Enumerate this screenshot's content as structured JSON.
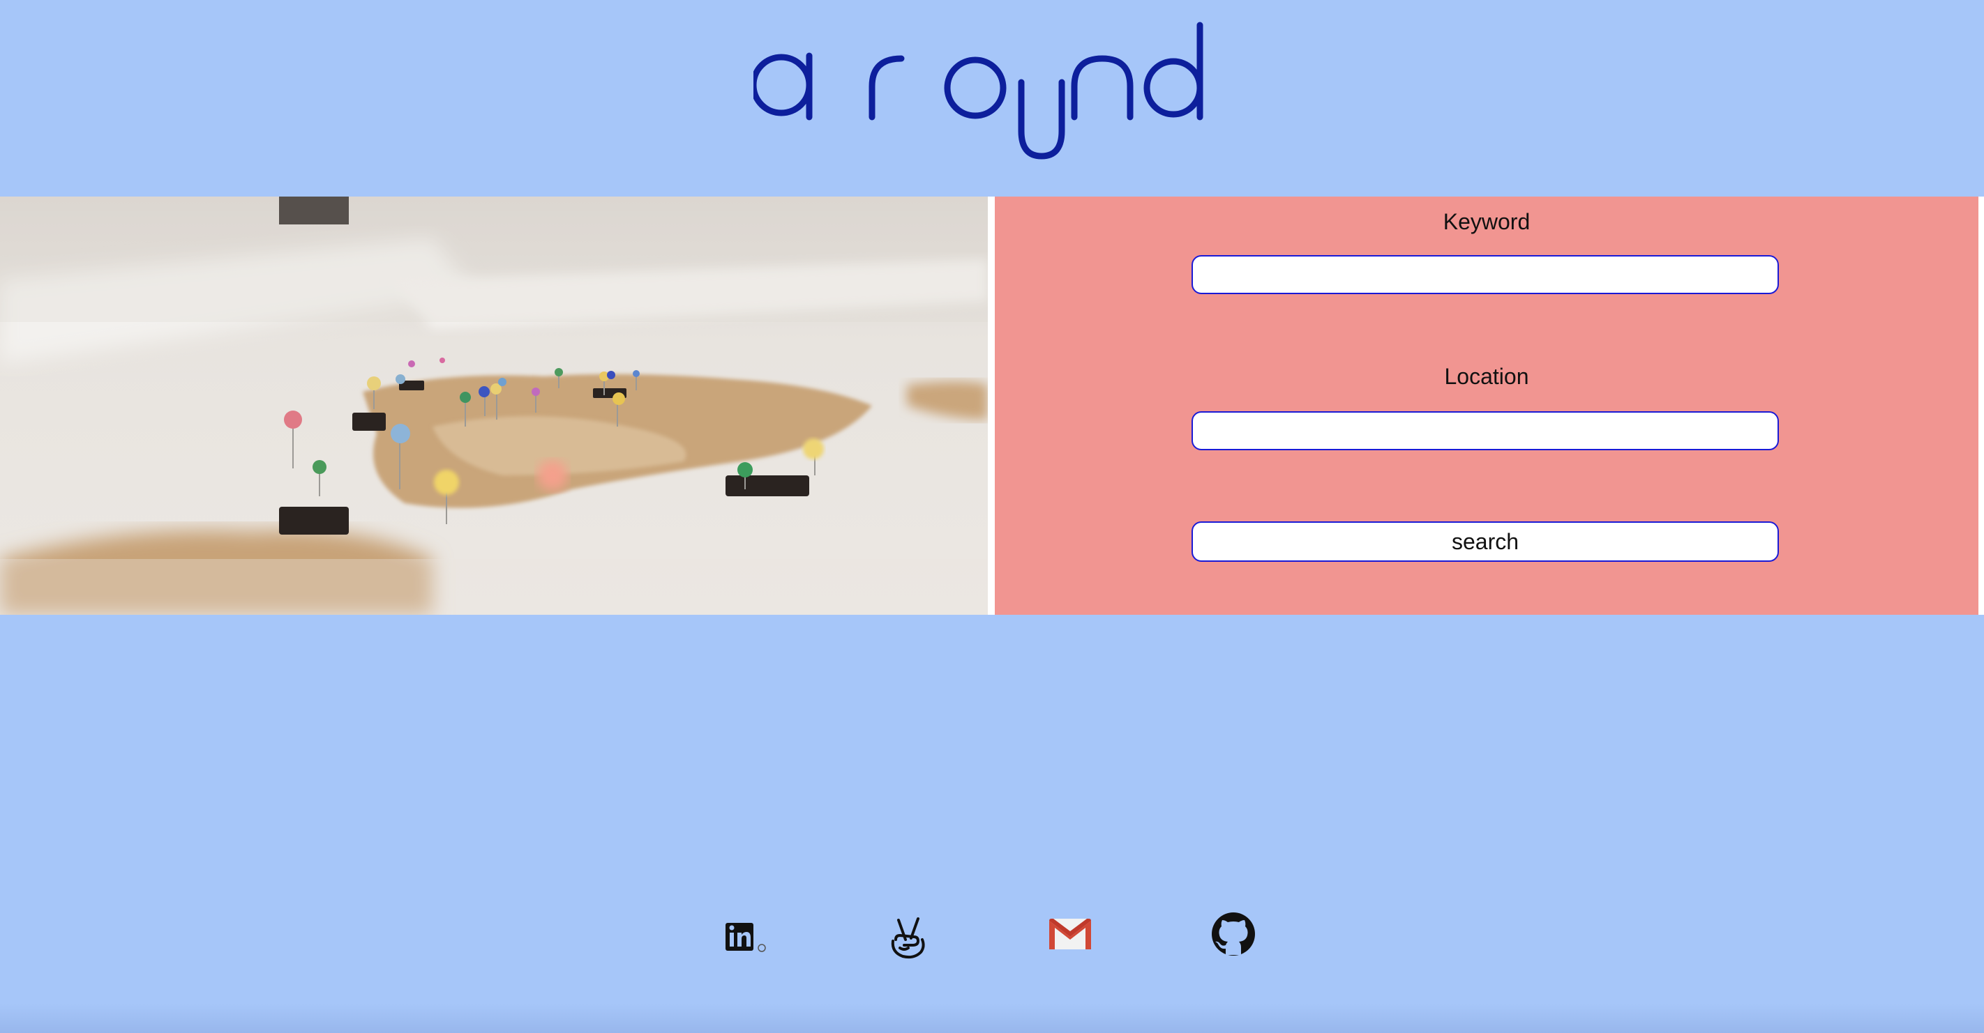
{
  "header": {
    "logo_name": "around-logo"
  },
  "hero": {
    "image_description_icon": "map-with-pins-image"
  },
  "search": {
    "keyword_label": "Keyword",
    "keyword_value": "",
    "location_label": "Location",
    "location_value": "",
    "button_label": "search"
  },
  "social": [
    {
      "icon": "linkedin-icon"
    },
    {
      "icon": "angellist-icon"
    },
    {
      "icon": "gmail-icon"
    },
    {
      "icon": "github-icon"
    }
  ],
  "colors": {
    "background": "#a6c6f9",
    "logo": "#0d1f9c",
    "panel": "#f19591",
    "input_border": "#1a1ad6"
  }
}
